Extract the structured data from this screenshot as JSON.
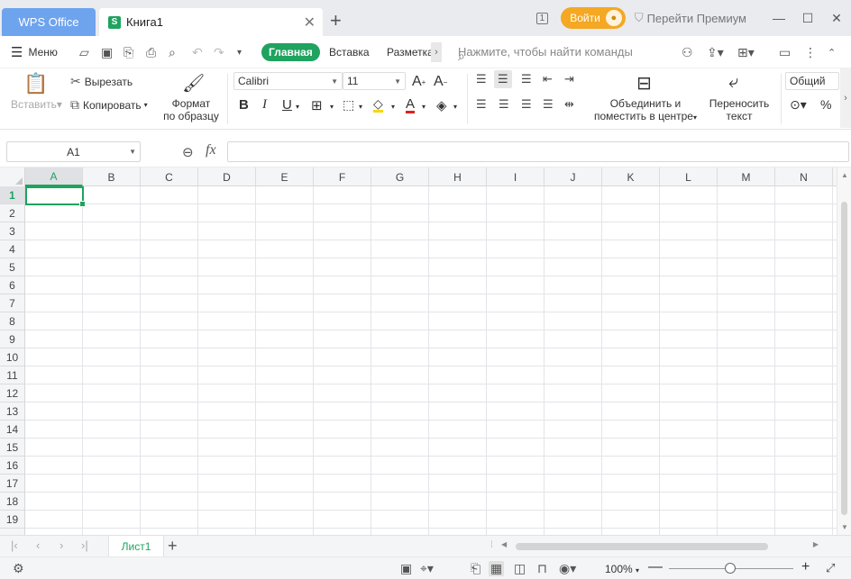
{
  "titlebar": {
    "app_tab_label": "WPS Office",
    "doc_tab_label": "Книга1",
    "doc_icon_glyph": "S",
    "login_label": "Войти",
    "premium_label": "Перейти Премиум",
    "page_counter": "1"
  },
  "menubar": {
    "menu_label": "Меню",
    "tabs": [
      "Главная",
      "Вставка",
      "Разметка"
    ],
    "search_placeholder": "Нажмите, чтобы найти команды"
  },
  "ribbon": {
    "paste_label": "Вставить",
    "cut_label": "Вырезать",
    "copy_label": "Копировать",
    "format_painter_line1": "Формат",
    "format_painter_line2": "по образцу",
    "font_name": "Calibri",
    "font_size": "11",
    "merge_line1": "Объединить и",
    "merge_line2": "поместить в центре",
    "wrap_line1": "Переносить",
    "wrap_line2": "текст",
    "number_format": "Общий",
    "bold_glyph": "B",
    "italic_glyph": "I",
    "underline_glyph": "U",
    "percent_glyph": "%"
  },
  "formulabar": {
    "name_box": "A1",
    "fx_label": "fx",
    "formula_value": ""
  },
  "grid": {
    "columns": [
      "A",
      "B",
      "C",
      "D",
      "E",
      "F",
      "G",
      "H",
      "I",
      "J",
      "K",
      "L",
      "M",
      "N"
    ],
    "rows": [
      "1",
      "2",
      "3",
      "4",
      "5",
      "6",
      "7",
      "8",
      "9",
      "10",
      "11",
      "12",
      "13",
      "14",
      "15",
      "16",
      "17",
      "18",
      "19"
    ],
    "active_cell": "A1"
  },
  "sheets": {
    "tabs": [
      "Лист1"
    ]
  },
  "statusbar": {
    "zoom_label": "100%"
  },
  "colors": {
    "accent": "#1fa35f",
    "wps_tab": "#6ea3ee",
    "login": "#f4a823"
  }
}
